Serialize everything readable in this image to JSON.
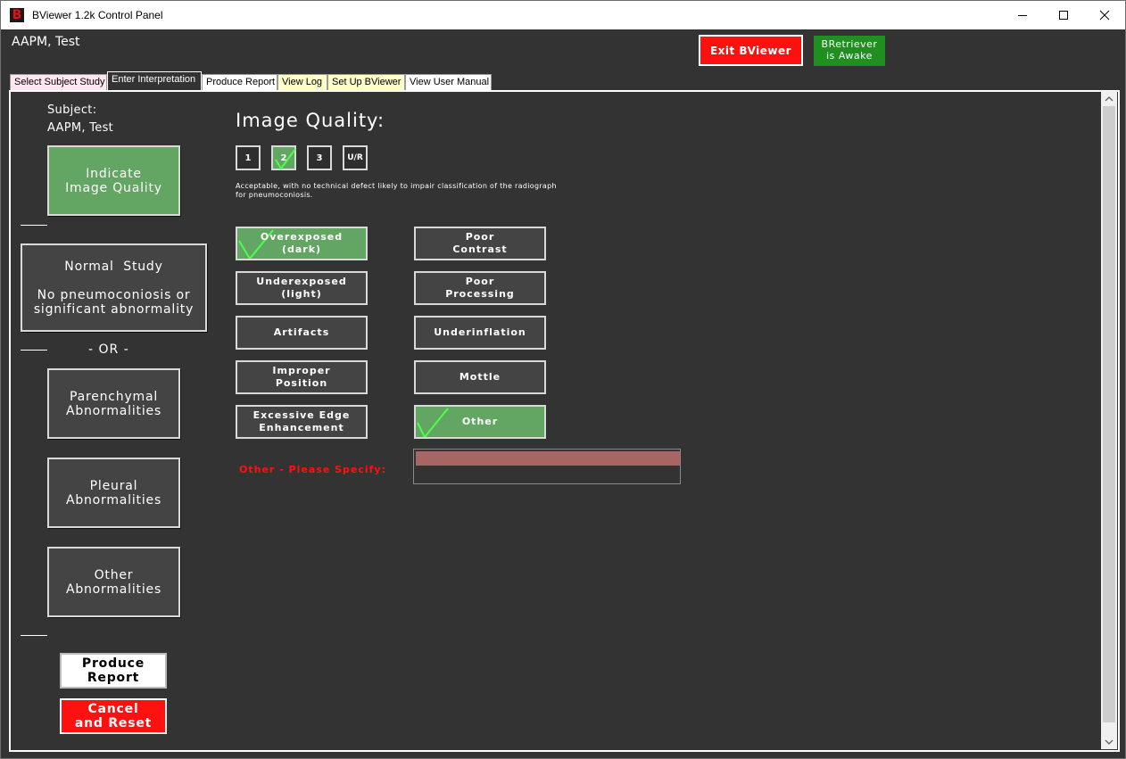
{
  "window": {
    "icon_letter": "B",
    "title": "BViewer 1.2k Control Panel"
  },
  "header": {
    "user_name": "AAPM, Test",
    "exit_label": "Exit BViewer",
    "bretriever_line1": "BRetriever",
    "bretriever_line2": "is Awake"
  },
  "tabs": [
    {
      "label": "Select Subject Study",
      "bg": "#ffe6f0",
      "active": false
    },
    {
      "label": "Enter Interpretation",
      "active": true
    },
    {
      "label": "Produce Report",
      "bg": "#ffffff",
      "active": false
    },
    {
      "label": "View Log",
      "bg": "#ffffcc",
      "active": false
    },
    {
      "label": "Set Up BViewer",
      "bg": "#ffffcc",
      "active": false
    },
    {
      "label": "View User Manual",
      "bg": "#ffffff",
      "active": false
    }
  ],
  "sidebar": {
    "subject_label": "Subject:",
    "subject_name": "AAPM, Test",
    "indicate_line1": "Indicate",
    "indicate_line2": "Image Quality",
    "normal_line1": "Normal  Study",
    "normal_line2": "No pneumoconiosis or",
    "normal_line3": "significant abnormality",
    "or_text": "- OR -",
    "parenchymal_line1": "Parenchymal",
    "parenchymal_line2": "Abnormalities",
    "pleural_line1": "Pleural",
    "pleural_line2": "Abnormalities",
    "other_line1": "Other",
    "other_line2": "Abnormalities",
    "produce_line1": "Produce",
    "produce_line2": "Report",
    "cancel_line1": "Cancel",
    "cancel_line2": "and Reset"
  },
  "image_quality": {
    "title": "Image Quality:",
    "grades": [
      {
        "label": "1",
        "selected": false
      },
      {
        "label": "2",
        "selected": true
      },
      {
        "label": "3",
        "selected": false
      },
      {
        "label": "U/R",
        "selected": false
      }
    ],
    "description_line1": "Acceptable, with no technical defect likely to impair classification of the radiograph",
    "description_line2": "for pneumoconiosis."
  },
  "defects": {
    "overexposed_line1": "Overexposed",
    "overexposed_line2": "(dark)",
    "underexposed_line1": "Underexposed",
    "underexposed_line2": "(light)",
    "artifacts": "Artifacts",
    "improper_line1": "Improper",
    "improper_line2": "Position",
    "excessive_line1": "Excessive Edge",
    "excessive_line2": "Enhancement",
    "poor_contrast_line1": "Poor",
    "poor_contrast_line2": "Contrast",
    "poor_processing_line1": "Poor",
    "poor_processing_line2": "Processing",
    "underinflation": "Underinflation",
    "mottle": "Mottle",
    "other": "Other",
    "selected": [
      "overexposed",
      "other"
    ]
  },
  "other_specify": {
    "label": "Other - Please Specify:",
    "value": ""
  },
  "colors": {
    "panel_bg": "#333333",
    "selected_green": "#63a663",
    "check_green": "#4cff4c",
    "exit_red": "#ff1111",
    "awake_green": "#1f8f1f",
    "input_bg": "#a86565"
  }
}
